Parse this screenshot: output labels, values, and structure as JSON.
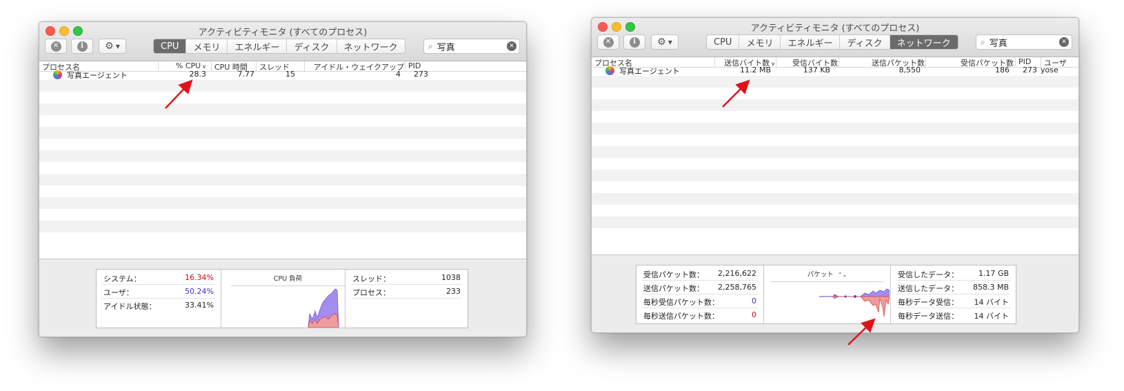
{
  "left_window": {
    "title": "アクティビティモニタ (すべてのプロセス)",
    "tabs": [
      {
        "label": "CPU",
        "active": true
      },
      {
        "label": "メモリ",
        "active": false
      },
      {
        "label": "エネルギー",
        "active": false
      },
      {
        "label": "ディスク",
        "active": false
      },
      {
        "label": "ネットワーク",
        "active": false
      }
    ],
    "search_value": "写真",
    "columns": [
      "プロセス名",
      "% CPU",
      "CPU 時間",
      "スレッド",
      "アイドル・ウェイクアップ",
      "PID"
    ],
    "row": {
      "name": "写真エージェント",
      "cpu": "28.3",
      "cpu_time": "7.77",
      "threads": "15",
      "idle_wakeups": "4",
      "pid": "273"
    },
    "summary": {
      "system_label": "システム：",
      "system_value": "16.34%",
      "user_label": "ユーザ：",
      "user_value": "50.24%",
      "idle_label": "アイドル状態：",
      "idle_value": "33.41%",
      "graph_title": "CPU 負荷",
      "threads_label": "スレッド：",
      "threads_value": "1038",
      "processes_label": "プロセス：",
      "processes_value": "233"
    },
    "colors": {
      "system": "#d0021b",
      "user": "#3d2dbf",
      "graph_user": "#a48cf0",
      "graph_system": "#f09c9c"
    }
  },
  "right_window": {
    "title": "アクティビティモニタ (すべてのプロセス)",
    "tabs": [
      {
        "label": "CPU",
        "active": false
      },
      {
        "label": "メモリ",
        "active": false
      },
      {
        "label": "エネルギー",
        "active": false
      },
      {
        "label": "ディスク",
        "active": false
      },
      {
        "label": "ネットワーク",
        "active": true
      }
    ],
    "search_value": "写真",
    "columns": [
      "プロセス名",
      "送信バイト数",
      "受信バイト数",
      "送信パケット数",
      "受信パケット数",
      "PID",
      "ユーザ"
    ],
    "row": {
      "name": "写真エージェント",
      "sent_bytes": "11.2 MB",
      "recv_bytes": "137 KB",
      "sent_packets": "8,550",
      "recv_packets": "186",
      "pid": "273",
      "user": "yose"
    },
    "summary": {
      "recv_packets_label": "受信パケット数：",
      "recv_packets_value": "2,216,622",
      "sent_packets_label": "送信パケット数：",
      "sent_packets_value": "2,258,765",
      "recv_pps_label": "毎秒受信パケット数：",
      "recv_pps_value": "0",
      "sent_pps_label": "毎秒送信パケット数：",
      "sent_pps_value": "0",
      "graph_title": "パケット",
      "data_recv_label": "受信したデータ：",
      "data_recv_value": "1.17 GB",
      "data_sent_label": "送信したデータ：",
      "data_sent_value": "858.3 MB",
      "data_recv_ps_label": "毎秒データ受信：",
      "data_recv_ps_value": "14 バイト",
      "data_sent_ps_label": "毎秒データ送信：",
      "data_sent_ps_value": "14 バイト"
    }
  }
}
